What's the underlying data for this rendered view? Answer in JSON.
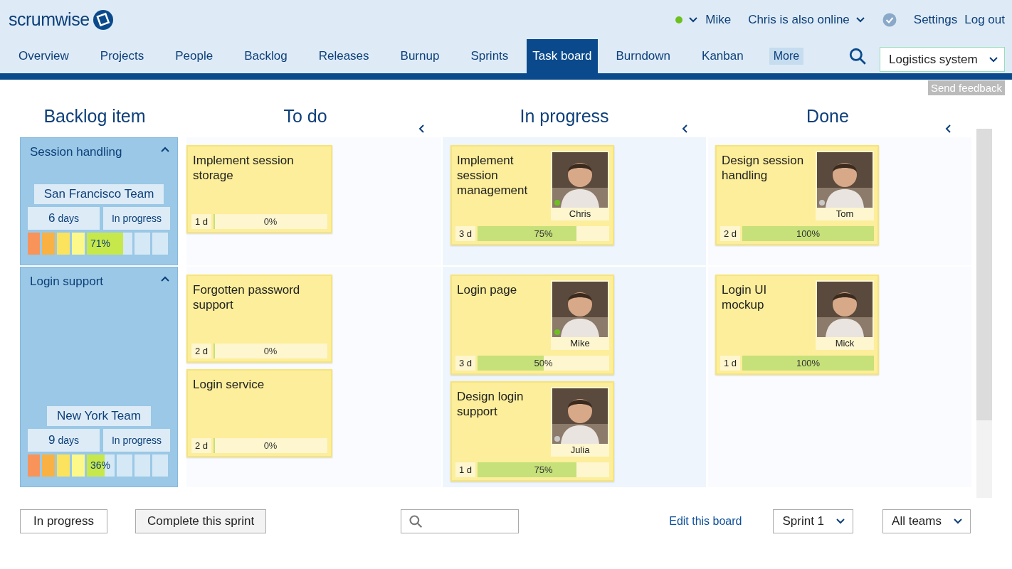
{
  "brand": {
    "name": "scrumwise"
  },
  "user_bar": {
    "online": true,
    "user": "Mike",
    "others": "Chris is also online",
    "verified": true,
    "links": [
      "Settings",
      "Log out"
    ]
  },
  "nav": {
    "tabs": [
      {
        "label": "Overview",
        "selected": false
      },
      {
        "label": "Projects",
        "selected": false
      },
      {
        "label": "People",
        "selected": false
      },
      {
        "label": "Backlog",
        "selected": false
      },
      {
        "label": "Releases",
        "selected": false
      },
      {
        "label": "Burnup",
        "selected": false
      },
      {
        "label": "Sprints",
        "selected": false
      },
      {
        "label": "Task board",
        "selected": true
      },
      {
        "label": "Burndown",
        "selected": false
      },
      {
        "label": "Kanban",
        "selected": false
      }
    ],
    "more": "More",
    "project": "Logistics system"
  },
  "feedback": "Send feedback",
  "board": {
    "columns": [
      {
        "title": "Backlog item",
        "collapsible": false
      },
      {
        "title": "To do",
        "collapsible": true
      },
      {
        "title": "In progress",
        "collapsible": true
      },
      {
        "title": "Done",
        "collapsible": true
      }
    ],
    "rows": [
      {
        "cells": [
          {
            "kind": "item",
            "title": "Session handling",
            "expanded": true,
            "team": "San Francisco Team",
            "days": "6",
            "days_unit": "days",
            "status": "In progress",
            "level": 0.67,
            "percent": "71%"
          },
          {
            "kind": "tasks",
            "cards": [
              {
                "title": "Implement session storage",
                "estimate": "1 d",
                "level": 0,
                "percent": "0%"
              }
            ]
          },
          {
            "kind": "tasks",
            "cards": [
              {
                "title": "Implement session management",
                "estimate": "3 d",
                "level": 0.75,
                "percent": "75%",
                "assignee": {
                  "name": "Chris",
                  "online": true
                }
              }
            ]
          },
          {
            "kind": "tasks",
            "cards": [
              {
                "title": "Design session handling",
                "estimate": "2 d",
                "level": 1,
                "percent": "100%",
                "assignee": {
                  "name": "Tom",
                  "online": false
                }
              }
            ]
          }
        ]
      },
      {
        "cells": [
          {
            "kind": "item",
            "title": "Login support",
            "expanded": true,
            "team": "New York Team",
            "days": "9",
            "days_unit": "days",
            "status": "In progress",
            "level": 0.54,
            "percent": "36%"
          },
          {
            "kind": "tasks",
            "cards": [
              {
                "title": "Forgotten password support",
                "estimate": "2 d",
                "level": 0,
                "percent": "0%"
              },
              {
                "title": "Login service",
                "estimate": "2 d",
                "level": 0,
                "percent": "0%"
              }
            ]
          },
          {
            "kind": "tasks",
            "cards": [
              {
                "title": "Login page",
                "estimate": "3 d",
                "level": 0.5,
                "percent": "50%",
                "assignee": {
                  "name": "Mike",
                  "online": true
                }
              },
              {
                "title": "Design login support",
                "estimate": "1 d",
                "level": 0.75,
                "percent": "75%",
                "assignee": {
                  "name": "Julia",
                  "online": false
                }
              }
            ]
          },
          {
            "kind": "tasks",
            "cards": [
              {
                "title": "Login UI mockup",
                "estimate": "1 d",
                "level": 1,
                "percent": "100%",
                "assignee": {
                  "name": "Mick"
                }
              }
            ]
          }
        ]
      }
    ]
  },
  "footer": {
    "state_button": "In progress",
    "complete_button": "Complete this sprint",
    "edit_link": "Edit this board",
    "sprint": "Sprint 1",
    "teams": "All teams"
  }
}
